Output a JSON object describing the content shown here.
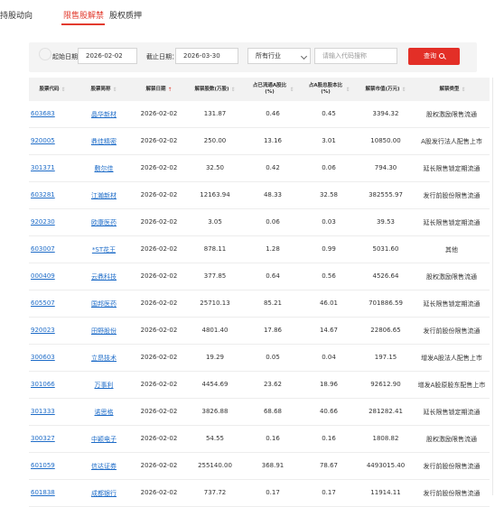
{
  "tabs": [
    "持股动向",
    "限售股解禁",
    "股权质押"
  ],
  "active_tab": 1,
  "filter": {
    "start_label": "起始日期：",
    "start_value": "2026-02-02",
    "end_label": "截止日期：",
    "end_value": "2026-03-30",
    "industry_value": "所有行业",
    "search_placeholder": "请输入代码搜称",
    "query_label": "查询"
  },
  "columns": [
    "股票代码",
    "股票简称",
    "解禁日期",
    "解禁股数(万股)",
    "占已流通A股比(%)",
    "占A股总股本比(%)",
    "解禁市值(万元)",
    "解禁类型"
  ],
  "rows": [
    [
      "603683",
      "晶华新材",
      "2026-02-02",
      "131.87",
      "0.46",
      "0.45",
      "3394.32",
      "股权激励限售流通"
    ],
    [
      "920005",
      "鼎佳精密",
      "2026-02-02",
      "250.00",
      "13.16",
      "3.01",
      "10850.00",
      "A股发行法人配售上市"
    ],
    [
      "301371",
      "敷尔佳",
      "2026-02-02",
      "32.50",
      "0.42",
      "0.06",
      "794.30",
      "延长限售锁定期流通"
    ],
    [
      "603281",
      "江瀚新材",
      "2026-02-02",
      "12163.94",
      "48.33",
      "32.58",
      "382555.97",
      "发行前股份限售流通"
    ],
    [
      "920230",
      "欧康医药",
      "2026-02-02",
      "3.05",
      "0.06",
      "0.03",
      "39.53",
      "延长限售锁定期流通"
    ],
    [
      "603007",
      "*ST花王",
      "2026-02-02",
      "878.11",
      "1.28",
      "0.99",
      "5031.60",
      "其他"
    ],
    [
      "000409",
      "云鼎科技",
      "2026-02-02",
      "377.85",
      "0.64",
      "0.56",
      "4526.64",
      "股权激励限售流通"
    ],
    [
      "605507",
      "国邦医药",
      "2026-02-02",
      "25710.13",
      "85.21",
      "46.01",
      "701886.59",
      "延长限售锁定期流通"
    ],
    [
      "920023",
      "田野股份",
      "2026-02-02",
      "4801.40",
      "17.86",
      "14.67",
      "22806.65",
      "发行前股份限售流通"
    ],
    [
      "300603",
      "立昂技术",
      "2026-02-02",
      "19.29",
      "0.05",
      "0.04",
      "197.15",
      "增发A股法人配售上市"
    ],
    [
      "301066",
      "万事利",
      "2026-02-02",
      "4454.69",
      "23.62",
      "18.96",
      "92612.90",
      "增发A股原股东配售上市"
    ],
    [
      "301333",
      "诺思格",
      "2026-02-02",
      "3826.88",
      "68.68",
      "40.66",
      "281282.41",
      "延长限售锁定期流通"
    ],
    [
      "300327",
      "中颖电子",
      "2026-02-02",
      "54.55",
      "0.16",
      "0.16",
      "1808.82",
      "股权激励限售流通"
    ],
    [
      "601059",
      "信达证券",
      "2026-02-02",
      "255140.00",
      "368.91",
      "78.67",
      "4493015.40",
      "发行前股份限售流通"
    ],
    [
      "601838",
      "成都银行",
      "2026-02-02",
      "737.72",
      "0.17",
      "0.17",
      "11914.11",
      "发行前股份限售流通"
    ]
  ],
  "icons": {
    "sort": "sort-arrows-icon",
    "sort_active": "sort-up-icon",
    "search": "search-icon",
    "dropdown": "chevron-down-icon"
  },
  "colors": {
    "accent": "#e23b2e",
    "link": "#1e6cc8",
    "button": "#e32f27"
  }
}
